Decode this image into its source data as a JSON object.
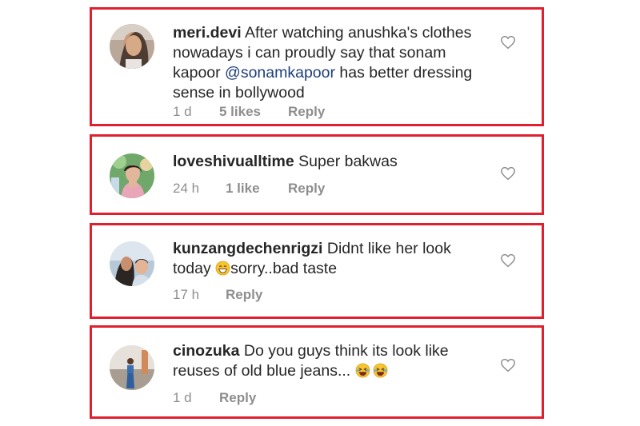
{
  "comments": [
    {
      "username": "meri.devi",
      "text_before": "After watching anushka's clothes nowadays i can proudly say that sonam kapoor ",
      "mention": "@sonamkapoor",
      "text_after": "  has better dressing sense in bollywood",
      "time": "1 d",
      "likes": "5 likes",
      "reply": "Reply"
    },
    {
      "username": "loveshivualltime",
      "text": "Super bakwas",
      "time": "24 h",
      "likes": "1 like",
      "reply": "Reply"
    },
    {
      "username": "kunzangdechenrigzi",
      "text_before": "Didnt like her look today ",
      "emoji": "grinning-face-emoji",
      "text_after": "sorry..bad taste",
      "time": "17 h",
      "reply": "Reply"
    },
    {
      "username": "cinozuka",
      "text": "Do you guys think  its look like reuses of old blue jeans... ",
      "emoji": "laughing-face-emoji",
      "time": "1 d",
      "reply": "Reply"
    }
  ],
  "colors": {
    "highlight_border": "#e0202e",
    "mention": "#1f3f7a",
    "meta_text": "#8e8e8e",
    "body_text": "#262626"
  },
  "icons": {
    "like": "heart-outline-icon"
  }
}
